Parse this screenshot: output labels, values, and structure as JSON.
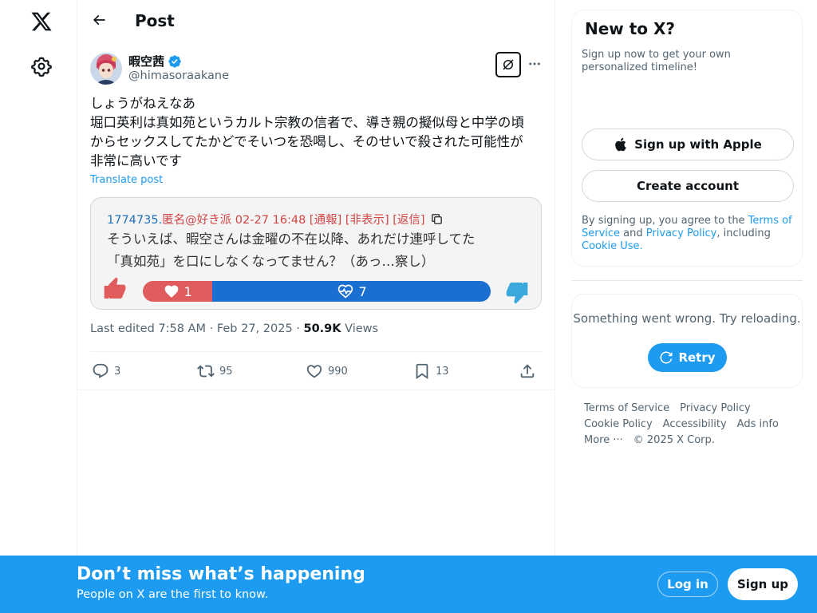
{
  "header": {
    "title": "Post"
  },
  "author": {
    "name": "暇空茜",
    "handle": "@himasoraakane"
  },
  "post": {
    "text": "しょうがねえなあ\n堀口英利は真如苑というカルト宗教の信者で、導き親の擬似母と中学の頃\nからセックスしてたかどでそいつを恐喝し、そのせいで殺された可能性が\n非常に高いです",
    "translate_label": "Translate post",
    "last_edited": "Last edited 7:58 AM · Feb 27, 2025 · ",
    "views_count": "50.9K",
    "views_label": " Views"
  },
  "media": {
    "post_number": "1774735.",
    "meta_text": "匿名@好き派 02-27 16:48 [通報] [非表示] [返信]",
    "body": "そういえば、暇空さんは金曜の不在以降、あれだけ連呼してた\n「真如苑」を口にしなくなってません？（あっ…察し）",
    "like_count": "1",
    "pulse_count": "7",
    "like_share": 0.2
  },
  "actions": {
    "replies": "3",
    "reposts": "95",
    "likes": "990",
    "bookmarks": "13"
  },
  "sidebar": {
    "signup_title": "New to X?",
    "signup_sub": "Sign up now to get your own personalized timeline!",
    "apple_label": "Sign up with Apple",
    "create_label": "Create account",
    "terms_prefix": "By signing up, you agree to the ",
    "terms_link": "Terms of Service",
    "terms_and": " and ",
    "privacy_link": "Privacy Policy",
    "terms_including": ", including ",
    "cookie_link": "Cookie Use.",
    "error_text": "Something went wrong. Try reloading.",
    "retry_label": "Retry",
    "footer": {
      "terms": "Terms of Service",
      "privacy": "Privacy Policy",
      "cookie": "Cookie Policy",
      "accessibility": "Accessibility",
      "ads": "Ads info",
      "more": "More ···",
      "copyright": "© 2025 X Corp."
    }
  },
  "banner": {
    "title": "Don’t miss what’s happening",
    "subtitle": "People on X are the first to know.",
    "login_label": "Log in",
    "signup_label": "Sign up"
  },
  "colors": {
    "accent": "#1d9bf0",
    "text_primary": "#0f1419",
    "text_secondary": "#536471",
    "verified": "#1d9bf0",
    "vote_like": "#e05b5b",
    "vote_pulse": "#1a6fd0"
  },
  "icons": [
    "x-logo-icon",
    "settings-gear-icon",
    "back-arrow-icon",
    "verified-badge-icon",
    "grok-icon",
    "more-dots-icon",
    "reply-icon",
    "repost-icon",
    "like-icon",
    "bookmark-icon",
    "share-icon",
    "apple-icon",
    "refresh-icon",
    "thumbs-up-icon",
    "thumbs-down-icon",
    "heart-icon",
    "heart-pulse-icon",
    "copy-icon"
  ]
}
